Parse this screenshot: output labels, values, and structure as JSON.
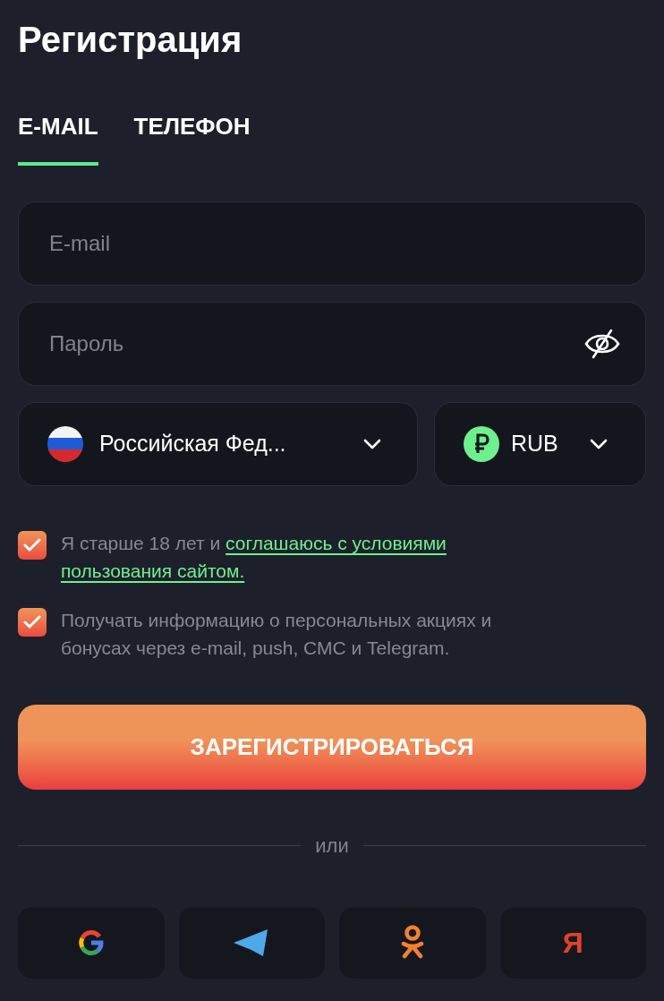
{
  "title": "Регистрация",
  "tabs": [
    {
      "label": "E-MAIL",
      "selected": true
    },
    {
      "label": "ТЕЛЕФОН",
      "selected": false
    }
  ],
  "email_field": {
    "placeholder": "E-mail"
  },
  "password_field": {
    "placeholder": "Пароль"
  },
  "country_select": {
    "value": "Российская Фед..."
  },
  "currency_select": {
    "value": "RUB"
  },
  "checkboxes": [
    {
      "text": "Я старше 18 лет и ",
      "link": [
        "соглашаюсь с условиями",
        "пользования сайтом."
      ],
      "checked": true
    },
    {
      "text": "Получать информацию о персональных акциях и бонусах через e-mail, push, СМС и Telegram.",
      "checked": true
    }
  ],
  "register_button": "ЗАРЕГИСТРИРОВАТЬСЯ",
  "divider_label": "или",
  "social_buttons": [
    {
      "kind": "google"
    },
    {
      "kind": "telegram"
    },
    {
      "kind": "ok"
    },
    {
      "kind": "yandex",
      "label": "Я"
    }
  ]
}
